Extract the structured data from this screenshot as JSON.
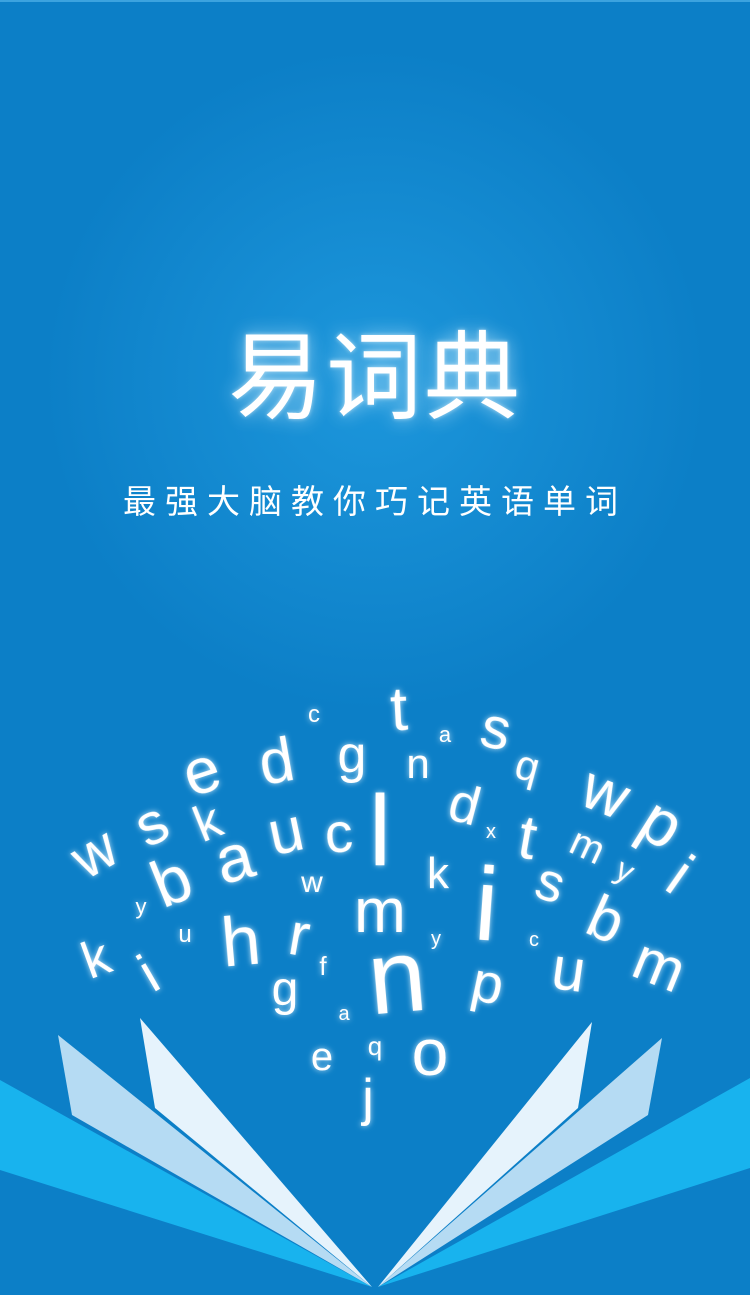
{
  "app": {
    "title": "易词典",
    "slogan": "最强大脑教你巧记英语单词"
  },
  "colors": {
    "background": "#0C7FC7",
    "background_glow": "#1D97DC",
    "page_light": "#E6F3FC",
    "page_mid": "#B5DBF3",
    "page_cyan": "#18B3EE",
    "text": "#FFFFFF"
  },
  "letters": [
    {
      "char": "t",
      "size": 62,
      "rot": -3
    },
    {
      "char": "c",
      "size": 24,
      "rot": 0
    },
    {
      "char": "a",
      "size": 22,
      "rot": 0
    },
    {
      "char": "s",
      "size": 58,
      "rot": 12
    },
    {
      "char": "e",
      "size": 64,
      "rot": -18
    },
    {
      "char": "d",
      "size": 62,
      "rot": -10
    },
    {
      "char": "g",
      "size": 52,
      "rot": 0
    },
    {
      "char": "n",
      "size": 42,
      "rot": 0
    },
    {
      "char": "q",
      "size": 42,
      "rot": 15
    },
    {
      "char": "w",
      "size": 62,
      "rot": 22
    },
    {
      "char": "w",
      "size": 58,
      "rot": -30
    },
    {
      "char": "s",
      "size": 58,
      "rot": -26
    },
    {
      "char": "k",
      "size": 50,
      "rot": -22
    },
    {
      "char": "b",
      "size": 66,
      "rot": -22
    },
    {
      "char": "a",
      "size": 66,
      "rot": -15
    },
    {
      "char": "u",
      "size": 62,
      "rot": -12
    },
    {
      "char": "c",
      "size": 56,
      "rot": -4
    },
    {
      "char": "l",
      "size": 100,
      "rot": 0
    },
    {
      "char": "d",
      "size": 54,
      "rot": 15
    },
    {
      "char": "x",
      "size": 20,
      "rot": 0
    },
    {
      "char": "t",
      "size": 62,
      "rot": 10
    },
    {
      "char": "m",
      "size": 40,
      "rot": 25
    },
    {
      "char": "p",
      "size": 66,
      "rot": 32
    },
    {
      "char": "y",
      "size": 22,
      "rot": 0
    },
    {
      "char": "w",
      "size": 30,
      "rot": 0
    },
    {
      "char": "k",
      "size": 44,
      "rot": 0
    },
    {
      "char": "y",
      "size": 32,
      "rot": 28
    },
    {
      "char": "i",
      "size": 62,
      "rot": 35
    },
    {
      "char": "i",
      "size": 104,
      "rot": 4
    },
    {
      "char": "s",
      "size": 54,
      "rot": 18
    },
    {
      "char": "b",
      "size": 60,
      "rot": 24
    },
    {
      "char": "u",
      "size": 24,
      "rot": 0
    },
    {
      "char": "h",
      "size": 70,
      "rot": -5
    },
    {
      "char": "r",
      "size": 60,
      "rot": 10
    },
    {
      "char": "m",
      "size": 62,
      "rot": 0
    },
    {
      "char": "y",
      "size": 20,
      "rot": 0
    },
    {
      "char": "c",
      "size": 20,
      "rot": 0
    },
    {
      "char": "k",
      "size": 52,
      "rot": -20
    },
    {
      "char": "i",
      "size": 56,
      "rot": -30
    },
    {
      "char": "u",
      "size": 60,
      "rot": 8
    },
    {
      "char": "m",
      "size": 60,
      "rot": 22
    },
    {
      "char": "f",
      "size": 26,
      "rot": 0
    },
    {
      "char": "g",
      "size": 48,
      "rot": 0
    },
    {
      "char": "n",
      "size": 104,
      "rot": -5
    },
    {
      "char": "p",
      "size": 56,
      "rot": 12
    },
    {
      "char": "a",
      "size": 20,
      "rot": 0
    },
    {
      "char": "e",
      "size": 40,
      "rot": 0
    },
    {
      "char": "q",
      "size": 26,
      "rot": 0
    },
    {
      "char": "o",
      "size": 66,
      "rot": 0
    },
    {
      "char": "j",
      "size": 52,
      "rot": 0
    }
  ]
}
